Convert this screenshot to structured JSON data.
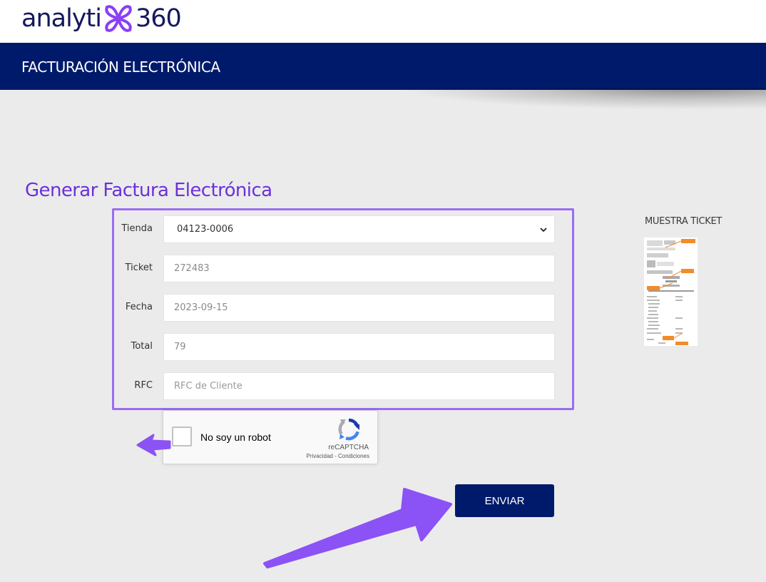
{
  "header": {
    "logo_left": "analyti",
    "logo_right": "360",
    "brand_color": "#14195c",
    "logo_accent": "#8a3ff5"
  },
  "navbar": {
    "title": "FACTURACIÓN ELECTRÓNICA",
    "background": "#001a6b"
  },
  "form": {
    "heading": "Generar Factura Electrónica",
    "heading_color": "#6a32d9",
    "highlight_color": "#9b6cf2",
    "fields": {
      "tienda": {
        "label": "Tienda",
        "value": "04123-0006"
      },
      "ticket": {
        "label": "Ticket",
        "value": "272483"
      },
      "fecha": {
        "label": "Fecha",
        "value": "2023-09-15"
      },
      "total": {
        "label": "Total",
        "value": "79"
      },
      "rfc": {
        "label": "RFC",
        "placeholder": "RFC de Cliente"
      }
    }
  },
  "recaptcha": {
    "label": "No soy un robot",
    "brand": "reCAPTCHA",
    "links": "Privacidad - Condiciones"
  },
  "submit": {
    "label": "ENVIAR"
  },
  "sample": {
    "title": "MUESTRA TICKET"
  },
  "icons": {
    "logo": "double-loop-logo-icon",
    "select": "chevron-down-icon",
    "captcha": "recaptcha-icon",
    "annotation": "arrow-icon"
  },
  "annotation_color": "#8b52f5"
}
